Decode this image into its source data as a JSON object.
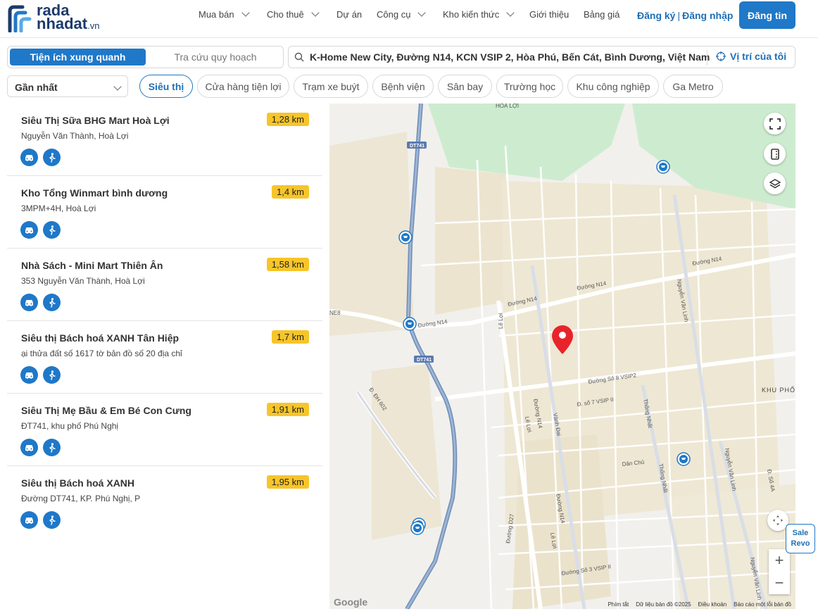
{
  "header": {
    "logo_line1": "rada",
    "logo_line2": "nhadat",
    "logo_suffix": ".vn",
    "nav": [
      "Mua bán",
      "Cho thuê",
      "Dự án",
      "Công cụ",
      "Kho kiến thức",
      "Giới thiệu",
      "Bảng giá"
    ],
    "register": "Đăng ký",
    "login": "Đăng nhập",
    "post_button": "Đăng tin"
  },
  "mode": {
    "active": "Tiện ích xung quanh",
    "other": "Tra cứu quy hoạch"
  },
  "search": {
    "value": "K-Home New City, Đường N14, KCN VSIP 2, Hòa Phú, Bến Cát, Bình Dương, Việt Nam",
    "locate_label": "Vị trí của tôi"
  },
  "filters": {
    "sort": "Gần nhất",
    "chips": [
      "Siêu thị",
      "Cửa hàng tiện lợi",
      "Trạm xe buýt",
      "Bệnh viện",
      "Sân bay",
      "Trường học",
      "Khu công nghiệp",
      "Ga Metro"
    ]
  },
  "places": [
    {
      "name": "Siêu Thị Sữa BHG Mart Hoà Lợi",
      "address": "Nguyễn Văn Thành, Hoà Lợi",
      "distance": "1,28 km"
    },
    {
      "name": "Kho Tổng Winmart bình dương",
      "address": "3MPM+4H, Hoà Lợi",
      "distance": "1,4 km"
    },
    {
      "name": "Nhà Sách - Mini Mart Thiên Ân",
      "address": "353 Nguyễn Văn Thành, Hoà Lợi",
      "distance": "1,58 km"
    },
    {
      "name": "Siêu thị Bách hoá XANH Tân Hiệp",
      "address": "ại thửa đất số 1617 tờ bản đồ số 20 địa chỉ",
      "distance": "1,7 km"
    },
    {
      "name": "Siêu Thị Mẹ Bầu & Em Bé Con Cưng",
      "address": "ĐT741, khu phố Phú Nghị",
      "distance": "1,91 km"
    },
    {
      "name": "Siêu thị Bách hoá XANH",
      "address": "Đường DT741, KP. Phú Nghị, P",
      "distance": "1,95 km"
    }
  ],
  "map": {
    "labels": {
      "hoa_loi": "HOÀ LỢI",
      "dt741a": "DT741",
      "dt741b": "DT741",
      "ne8": "NE8",
      "n14a": "Đường N14",
      "n14b": "Đường N14",
      "n14c": "Đường N14",
      "n14d": "Đường N14",
      "leloi1": "Lê Lợi",
      "leloi2": "Lê Lợi",
      "leloi3": "Lê Lợi",
      "so8": "Đường Số 8 VSIP2",
      "so7": "Đ. số 7 VSIP II",
      "so3": "Đường Số 3 VSIP II",
      "dh602": "Đ. ĐH 602",
      "n14v": "Đường N14",
      "n14v2": "Đường N14",
      "vanhdai": "Vành Đai",
      "thongnhat1": "Thống Nhất",
      "thongnhat2": "Thống Nhất",
      "nvl1": "Nguyễn Văn Linh",
      "nvl2": "Nguyễn Văn Linh",
      "nvl3": "Nguyễn Văn Linh",
      "danchu": "Dân Chủ",
      "d27": "Đường D27",
      "so4": "Đ. Số 4A",
      "khupho": "KHU PHỐ"
    },
    "footer": [
      "Phím tắt",
      "Dữ liệu bản đồ ©2025",
      "Điều khoản",
      "Báo cáo một lỗi bản đồ"
    ],
    "google": "Google",
    "zoom_in": "+",
    "zoom_out": "−"
  },
  "sale_badge": {
    "line1": "Sale",
    "line2": "Revo"
  },
  "colors": {
    "primary": "#1f78c8",
    "distance_badge": "#f7c52a",
    "pin": "#e8242b"
  }
}
